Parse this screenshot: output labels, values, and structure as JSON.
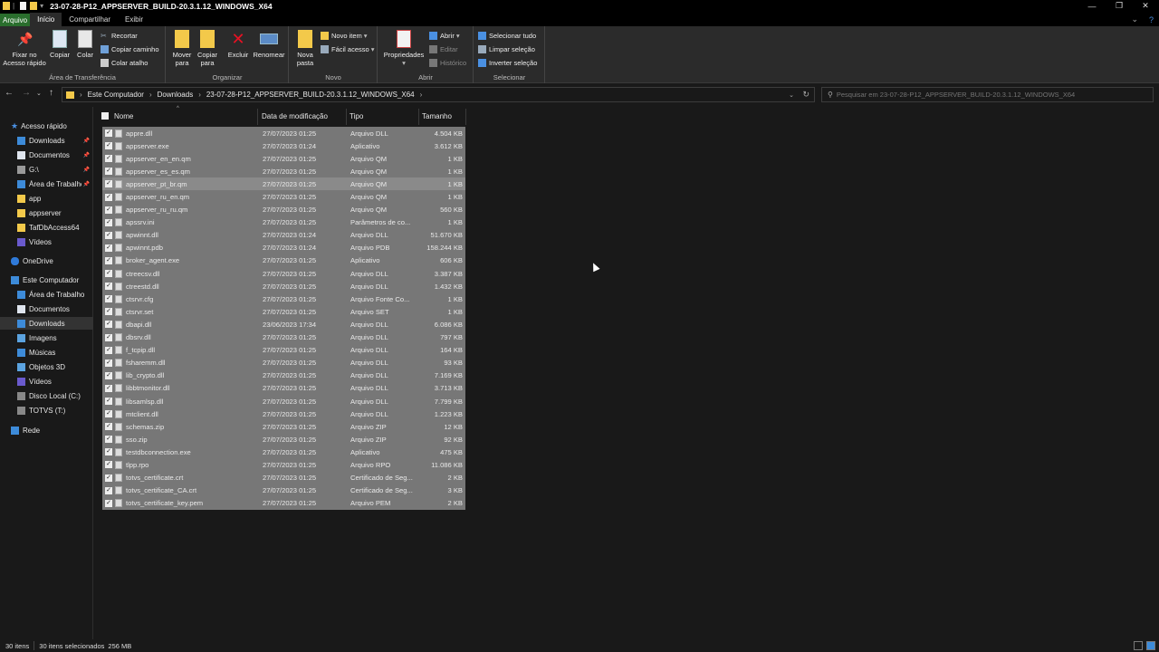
{
  "window": {
    "title": "23-07-28-P12_APPSERVER_BUILD-20.3.1.12_WINDOWS_X64",
    "controls": {
      "minimize": "—",
      "maximize": "❐",
      "close": "✕"
    }
  },
  "ribbon_tabs": {
    "file": "Arquivo",
    "home": "Início",
    "share": "Compartilhar",
    "view": "Exibir"
  },
  "ribbon": {
    "clipboard": {
      "label": "Área de Transferência",
      "pin": "Fixar no Acesso rápido",
      "copy": "Copiar",
      "paste": "Colar",
      "cut": "Recortar",
      "copy_path": "Copiar caminho",
      "paste_shortcut": "Colar atalho"
    },
    "organize": {
      "label": "Organizar",
      "move_to": "Mover para",
      "copy_to": "Copiar para",
      "delete": "Excluir",
      "rename": "Renomear"
    },
    "new": {
      "label": "Novo",
      "new_folder": "Nova pasta",
      "new_item": "Novo item",
      "easy_access": "Fácil acesso"
    },
    "open": {
      "label": "Abrir",
      "properties": "Propriedades",
      "open": "Abrir",
      "edit": "Editar",
      "history": "Histórico"
    },
    "select": {
      "label": "Selecionar",
      "select_all": "Selecionar tudo",
      "select_none": "Limpar seleção",
      "invert": "Inverter seleção"
    }
  },
  "address": {
    "crumbs": [
      "Este Computador",
      "Downloads",
      "23-07-28-P12_APPSERVER_BUILD-20.3.1.12_WINDOWS_X64"
    ],
    "search_placeholder": "Pesquisar em 23-07-28-P12_APPSERVER_BUILD-20.3.1.12_WINDOWS_X64"
  },
  "nav": {
    "quick_access": "Acesso rápido",
    "downloads": "Downloads",
    "documents": "Documentos",
    "g_drive": "G:\\",
    "desktop": "Área de Trabalho",
    "app": "app",
    "appserver": "appserver",
    "tafdb": "TafDbAccess64",
    "videos": "Vídeos",
    "onedrive": "OneDrive",
    "this_pc": "Este Computador",
    "pc_desktop": "Área de Trabalho",
    "pc_documents": "Documentos",
    "pc_downloads": "Downloads",
    "pc_images": "Imagens",
    "pc_music": "Músicas",
    "pc_3d": "Objetos 3D",
    "pc_videos": "Vídeos",
    "local_disk": "Disco Local (C:)",
    "totvs": "TOTVS (T:)",
    "network": "Rede"
  },
  "columns": {
    "name": "Nome",
    "date": "Data de modificação",
    "type": "Tipo",
    "size": "Tamanho"
  },
  "files": [
    {
      "name": "appre.dll",
      "date": "27/07/2023 01:25",
      "type": "Arquivo DLL",
      "size": "4.504 KB"
    },
    {
      "name": "appserver.exe",
      "date": "27/07/2023 01:24",
      "type": "Aplicativo",
      "size": "3.612 KB"
    },
    {
      "name": "appserver_en_en.qm",
      "date": "27/07/2023 01:25",
      "type": "Arquivo QM",
      "size": "1 KB"
    },
    {
      "name": "appserver_es_es.qm",
      "date": "27/07/2023 01:25",
      "type": "Arquivo QM",
      "size": "1 KB"
    },
    {
      "name": "appserver_pt_br.qm",
      "date": "27/07/2023 01:25",
      "type": "Arquivo QM",
      "size": "1 KB"
    },
    {
      "name": "appserver_ru_en.qm",
      "date": "27/07/2023 01:25",
      "type": "Arquivo QM",
      "size": "1 KB"
    },
    {
      "name": "appserver_ru_ru.qm",
      "date": "27/07/2023 01:25",
      "type": "Arquivo QM",
      "size": "560 KB"
    },
    {
      "name": "apssrv.ini",
      "date": "27/07/2023 01:25",
      "type": "Parâmetros de co...",
      "size": "1 KB"
    },
    {
      "name": "apwinnt.dll",
      "date": "27/07/2023 01:24",
      "type": "Arquivo DLL",
      "size": "51.670 KB"
    },
    {
      "name": "apwinnt.pdb",
      "date": "27/07/2023 01:24",
      "type": "Arquivo PDB",
      "size": "158.244 KB"
    },
    {
      "name": "broker_agent.exe",
      "date": "27/07/2023 01:25",
      "type": "Aplicativo",
      "size": "606 KB"
    },
    {
      "name": "ctreecsv.dll",
      "date": "27/07/2023 01:25",
      "type": "Arquivo DLL",
      "size": "3.387 KB"
    },
    {
      "name": "ctreestd.dll",
      "date": "27/07/2023 01:25",
      "type": "Arquivo DLL",
      "size": "1.432 KB"
    },
    {
      "name": "ctsrvr.cfg",
      "date": "27/07/2023 01:25",
      "type": "Arquivo Fonte Co...",
      "size": "1 KB"
    },
    {
      "name": "ctsrvr.set",
      "date": "27/07/2023 01:25",
      "type": "Arquivo SET",
      "size": "1 KB"
    },
    {
      "name": "dbapi.dll",
      "date": "23/06/2023 17:34",
      "type": "Arquivo DLL",
      "size": "6.086 KB"
    },
    {
      "name": "dbsrv.dll",
      "date": "27/07/2023 01:25",
      "type": "Arquivo DLL",
      "size": "797 KB"
    },
    {
      "name": "f_tcpip.dll",
      "date": "27/07/2023 01:25",
      "type": "Arquivo DLL",
      "size": "164 KB"
    },
    {
      "name": "fsharemm.dll",
      "date": "27/07/2023 01:25",
      "type": "Arquivo DLL",
      "size": "93 KB"
    },
    {
      "name": "lib_crypto.dll",
      "date": "27/07/2023 01:25",
      "type": "Arquivo DLL",
      "size": "7.169 KB"
    },
    {
      "name": "libbtmonitor.dll",
      "date": "27/07/2023 01:25",
      "type": "Arquivo DLL",
      "size": "3.713 KB"
    },
    {
      "name": "libsamlsp.dll",
      "date": "27/07/2023 01:25",
      "type": "Arquivo DLL",
      "size": "7.799 KB"
    },
    {
      "name": "mtclient.dll",
      "date": "27/07/2023 01:25",
      "type": "Arquivo DLL",
      "size": "1.223 KB"
    },
    {
      "name": "schemas.zip",
      "date": "27/07/2023 01:25",
      "type": "Arquivo ZIP",
      "size": "12 KB"
    },
    {
      "name": "sso.zip",
      "date": "27/07/2023 01:25",
      "type": "Arquivo ZIP",
      "size": "92 KB"
    },
    {
      "name": "testdbconnection.exe",
      "date": "27/07/2023 01:25",
      "type": "Aplicativo",
      "size": "475 KB"
    },
    {
      "name": "tlpp.rpo",
      "date": "27/07/2023 01:25",
      "type": "Arquivo RPO",
      "size": "11.086 KB"
    },
    {
      "name": "totvs_certificate.crt",
      "date": "27/07/2023 01:25",
      "type": "Certificado de Seg...",
      "size": "2 KB"
    },
    {
      "name": "totvs_certificate_CA.crt",
      "date": "27/07/2023 01:25",
      "type": "Certificado de Seg...",
      "size": "3 KB"
    },
    {
      "name": "totvs_certificate_key.pem",
      "date": "27/07/2023 01:25",
      "type": "Arquivo PEM",
      "size": "2 KB"
    }
  ],
  "status": {
    "items": "30 itens",
    "selected": "30 itens selecionados",
    "size": "256 MB"
  },
  "colors": {
    "selection": "#777777",
    "folder": "#f3c94a",
    "accent": "#2a6e2d"
  }
}
